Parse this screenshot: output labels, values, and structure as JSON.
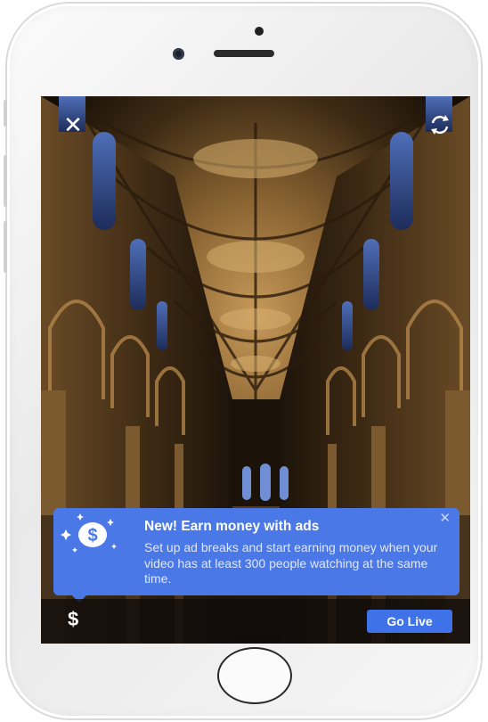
{
  "device": {
    "model": "iphone"
  },
  "live": {
    "close_icon": "close-icon",
    "flip_icon": "camera-switch-icon",
    "background": "cathedral-interior-camera-view"
  },
  "tooltip": {
    "title": "New! Earn money with ads",
    "body": "Set up ad breaks and start earning money when your video has at least 300 people watching at the same time.",
    "close_glyph": "✕",
    "icon": "dollar-sparkle-icon",
    "background_color": "#4a78e6"
  },
  "bottom_bar": {
    "dollar_label": "$",
    "go_live_label": "Go Live",
    "go_live_color": "#3f72e8"
  }
}
